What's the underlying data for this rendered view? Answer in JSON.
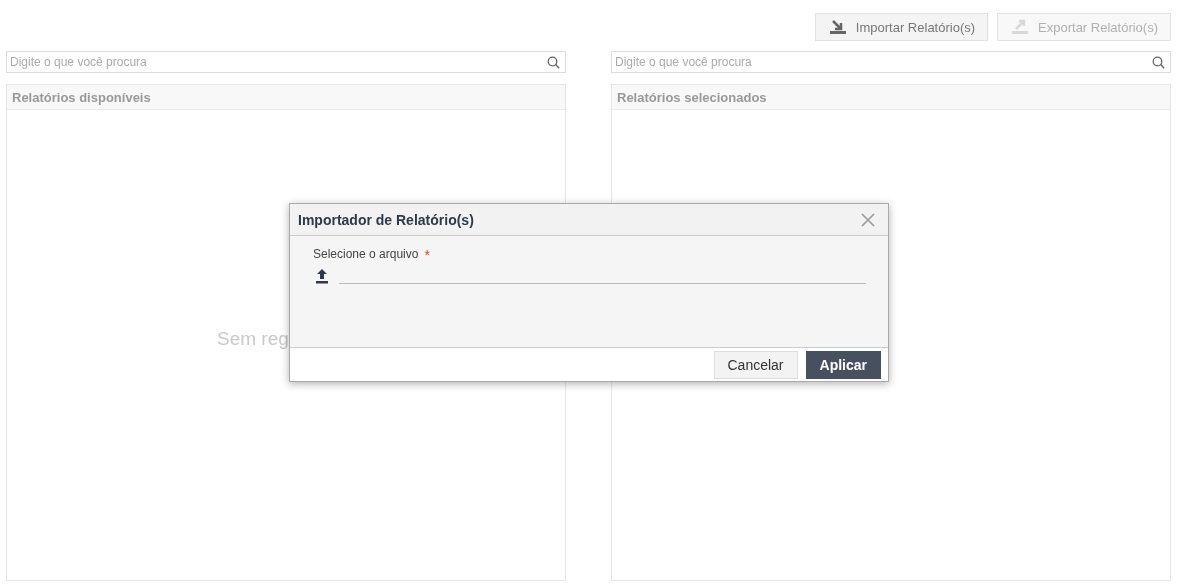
{
  "toolbar": [
    {
      "label": "Importar Relatório(s)",
      "kind": "import",
      "disabled": false
    },
    {
      "label": "Exportar Relatório(s)",
      "kind": "export",
      "disabled": true
    }
  ],
  "panels": [
    {
      "search": {
        "placeholder": "Digite o que você procura"
      },
      "title": "Relatórios disponíveis",
      "empty_text": "Sem reg"
    },
    {
      "search": {
        "placeholder": "Digite o que você procura"
      },
      "title": "Relatórios selecionados"
    }
  ],
  "dialog": {
    "title": "Importador de Relatório(s)",
    "field_label": "Selecione o arquivo",
    "required_mark": "*",
    "buttons": [
      {
        "label": "Cancelar",
        "kind": "secondary"
      },
      {
        "label": "Aplicar",
        "kind": "primary"
      }
    ]
  }
}
